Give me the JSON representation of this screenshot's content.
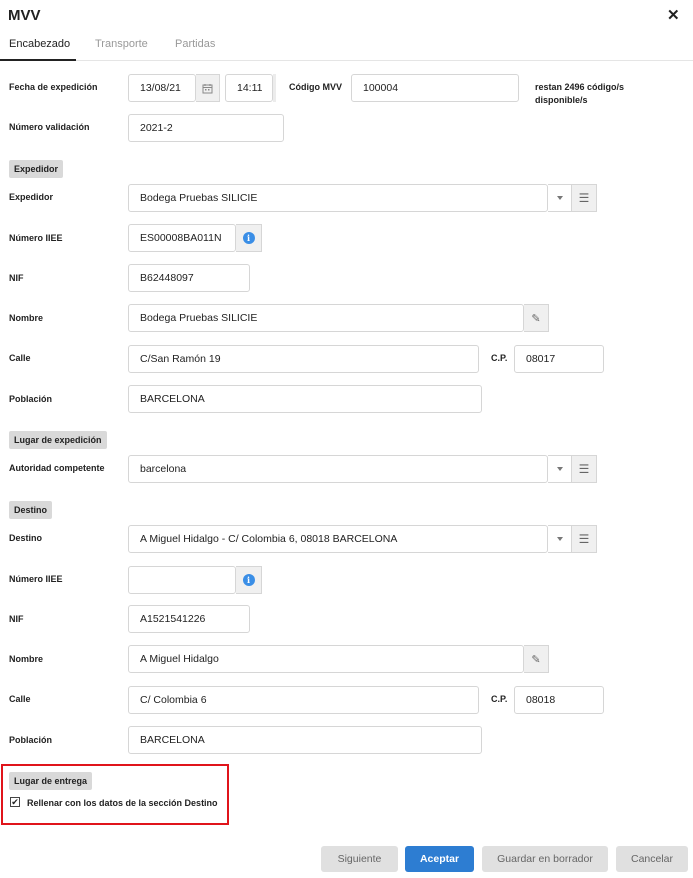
{
  "header": {
    "title": "MVV",
    "close_icon": "close-icon"
  },
  "tabs": [
    {
      "label": "Encabezado",
      "active": true
    },
    {
      "label": "Transporte",
      "active": false
    },
    {
      "label": "Partidas",
      "active": false
    }
  ],
  "top": {
    "fecha_label": "Fecha de expedición",
    "fecha_value": "13/08/21",
    "hora_value": "14:11",
    "codigo_label": "Código MVV",
    "codigo_value": "100004",
    "restan_note": "restan 2496 código/s disponible/s",
    "numero_label": "Número validación",
    "numero_value": "2021-2"
  },
  "expedidor": {
    "section": "Expedidor",
    "expedidor_label": "Expedidor",
    "expedidor_value": "Bodega Pruebas SILICIE",
    "iiee_label": "Número IIEE",
    "iiee_value": "ES00008BA011N",
    "nif_label": "NIF",
    "nif_value": "B62448097",
    "nombre_label": "Nombre",
    "nombre_value": "Bodega Pruebas SILICIE",
    "calle_label": "Calle",
    "calle_value": "C/San Ramón 19",
    "cp_label": "C.P.",
    "cp_value": "08017",
    "poblacion_label": "Población",
    "poblacion_value": "BARCELONA"
  },
  "lugar_expedicion": {
    "section": "Lugar de expedición",
    "autoridad_label": "Autoridad competente",
    "autoridad_value": "barcelona"
  },
  "destino": {
    "section": "Destino",
    "destino_label": "Destino",
    "destino_value": "A Miguel Hidalgo - C/ Colombia 6, 08018 BARCELONA",
    "iiee_label": "Número IIEE",
    "iiee_value": "",
    "nif_label": "NIF",
    "nif_value": "A1521541226",
    "nombre_label": "Nombre",
    "nombre_value": "A Miguel Hidalgo",
    "calle_label": "Calle",
    "calle_value": "C/ Colombia 6",
    "cp_label": "C.P.",
    "cp_value": "08018",
    "poblacion_label": "Población",
    "poblacion_value": "BARCELONA"
  },
  "lugar_entrega": {
    "section": "Lugar de entrega",
    "checkbox_label": "Rellenar con los datos de la sección Destino",
    "checked": true
  },
  "footer": {
    "siguiente": "Siguiente",
    "aceptar": "Aceptar",
    "guardar": "Guardar en borrador",
    "cancelar": "Cancelar"
  },
  "colors": {
    "primary": "#2d7dd2",
    "highlight": "#e0141b",
    "info": "#3a8ee6"
  }
}
